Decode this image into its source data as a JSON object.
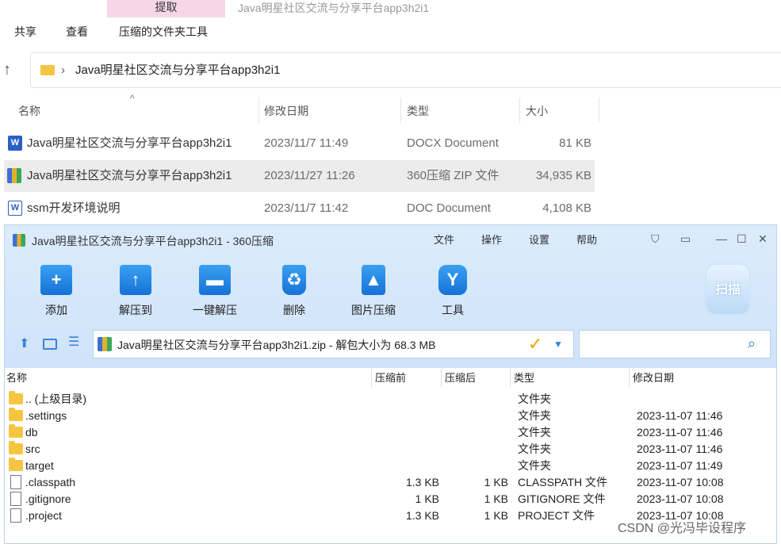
{
  "explorer": {
    "context_tab": "提取",
    "window_title": "Java明星社区交流与分享平台app3h2i1",
    "ribbon_tabs": [
      "共享",
      "查看",
      "压缩的文件夹工具"
    ],
    "up_icon": "↑",
    "breadcrumb_sep": "›",
    "breadcrumb": "Java明星社区交流与分享平台app3h2i1",
    "sort_glyph": "^",
    "columns": {
      "name": "名称",
      "date": "修改日期",
      "type": "类型",
      "size": "大小"
    },
    "files": [
      {
        "name": "Java明星社区交流与分享平台app3h2i1",
        "date": "2023/11/7 11:49",
        "type": "DOCX Document",
        "size": "81 KB",
        "icon": "word-icon"
      },
      {
        "name": "Java明星社区交流与分享平台app3h2i1",
        "date": "2023/11/27 11:26",
        "type": "360压缩 ZIP 文件",
        "size": "34,935 KB",
        "icon": "zip-icon"
      },
      {
        "name": "ssm开发环境说明",
        "date": "2023/11/7 11:42",
        "type": "DOC Document",
        "size": "4,108 KB",
        "icon": "word-icon"
      }
    ]
  },
  "zipwin": {
    "title": "Java明星社区交流与分享平台app3h2i1 - 360压缩",
    "menu": [
      "文件",
      "操作",
      "设置",
      "帮助"
    ],
    "toolbar": [
      "添加",
      "解压到",
      "一键解压",
      "删除",
      "图片压缩",
      "工具"
    ],
    "scan_label": "扫描",
    "path": "Java明星社区交流与分享平台app3h2i1.zip - 解包大小为 68.3 MB",
    "columns": {
      "name": "名称",
      "before": "压缩前",
      "after": "压缩后",
      "type": "类型",
      "date": "修改日期"
    },
    "entries": [
      {
        "name": ".. (上级目录)",
        "before": "",
        "after": "",
        "type": "文件夹",
        "date": "",
        "icon": "folder-icon"
      },
      {
        "name": ".settings",
        "before": "",
        "after": "",
        "type": "文件夹",
        "date": "2023-11-07 11:46",
        "icon": "folder-icon"
      },
      {
        "name": "db",
        "before": "",
        "after": "",
        "type": "文件夹",
        "date": "2023-11-07 11:46",
        "icon": "folder-icon"
      },
      {
        "name": "src",
        "before": "",
        "after": "",
        "type": "文件夹",
        "date": "2023-11-07 11:46",
        "icon": "folder-icon"
      },
      {
        "name": "target",
        "before": "",
        "after": "",
        "type": "文件夹",
        "date": "2023-11-07 11:49",
        "icon": "folder-icon"
      },
      {
        "name": ".classpath",
        "before": "1.3 KB",
        "after": "1 KB",
        "type": "CLASSPATH 文件",
        "date": "2023-11-07 10:08",
        "icon": "file-icon"
      },
      {
        "name": ".gitignore",
        "before": "1 KB",
        "after": "1 KB",
        "type": "GITIGNORE 文件",
        "date": "2023-11-07 10:08",
        "icon": "file-icon"
      },
      {
        "name": ".project",
        "before": "1.3 KB",
        "after": "1 KB",
        "type": "PROJECT 文件",
        "date": "2023-11-07 10:08",
        "icon": "file-icon"
      }
    ]
  },
  "watermark": "CSDN @光冯毕设程序"
}
